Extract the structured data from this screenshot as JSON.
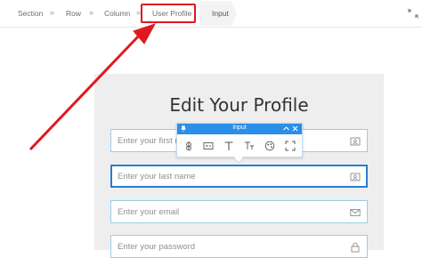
{
  "breadcrumb": {
    "items": [
      "Section",
      "Row",
      "Column",
      "User Profile"
    ],
    "separator": "»",
    "current": "Input"
  },
  "form": {
    "heading": "Edit Your Profile",
    "fields": [
      {
        "placeholder": "Enter your first name",
        "icon": "id-card-icon"
      },
      {
        "placeholder": "Enter your last name",
        "icon": "id-card-icon"
      },
      {
        "placeholder": "Enter your email",
        "icon": "envelope-icon"
      },
      {
        "placeholder": "Enter your password",
        "icon": "lock-icon"
      }
    ]
  },
  "toolbar": {
    "title": "Input",
    "tools": [
      "link-icon",
      "field-settings-icon",
      "text-icon",
      "text-size-icon",
      "style-icon",
      "fullscreen-icon"
    ]
  },
  "colors": {
    "highlight": "#e0191f",
    "toolbar_header": "#2b8ee8",
    "field_border": "#9ecbe9",
    "selected_border": "#2b7bd0"
  }
}
